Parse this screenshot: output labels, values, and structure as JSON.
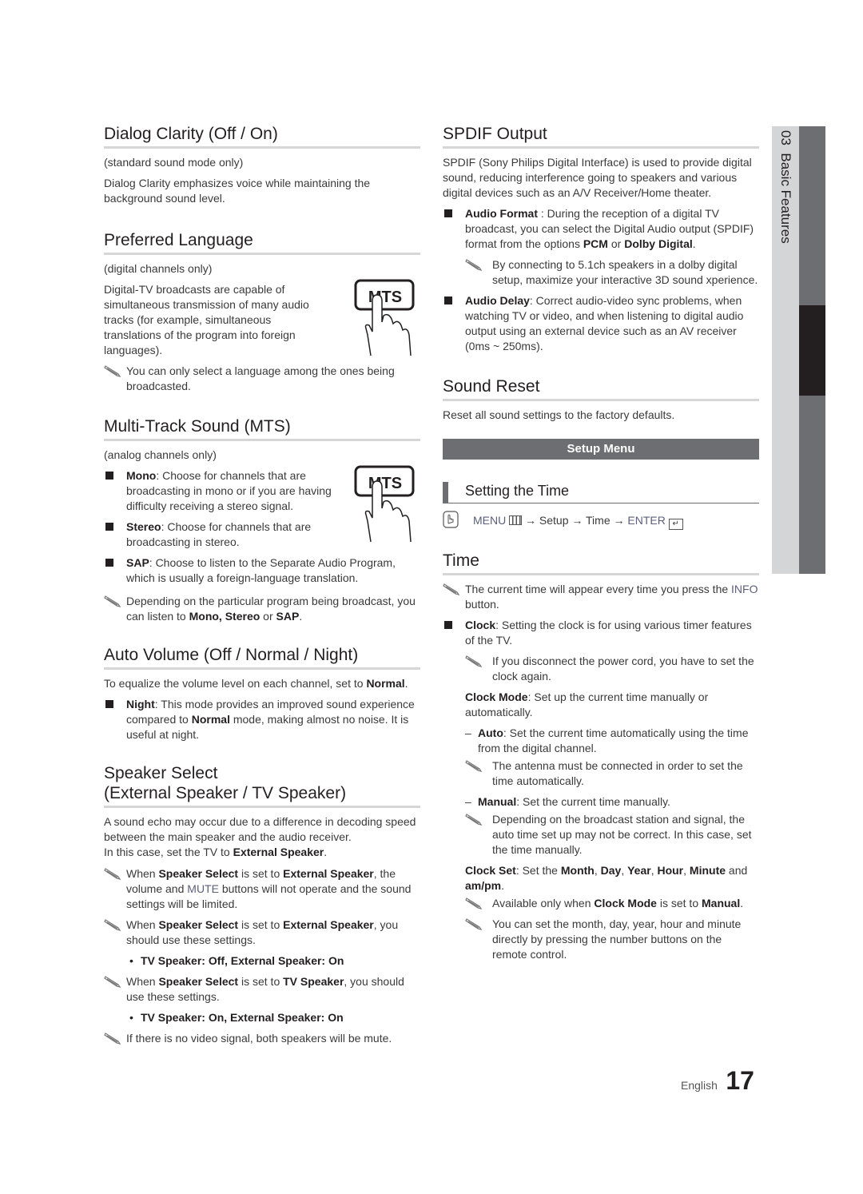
{
  "side_tab": {
    "chapter": "03",
    "title": "Basic Features"
  },
  "footer": {
    "language": "English",
    "page_number": "17"
  },
  "left": {
    "dialog_clarity": {
      "title": "Dialog Clarity (Off / On)",
      "scope": "(standard sound mode only)",
      "body": "Dialog Clarity emphasizes voice while maintaining the background sound level."
    },
    "preferred_language": {
      "title": "Preferred Language",
      "scope": "(digital channels only)",
      "body": "Digital-TV broadcasts are capable of simultaneous transmission of many audio tracks (for example, simultaneous translations of the program into foreign languages).",
      "note": "You can only select a language among the ones being broadcasted.",
      "remote_button": "MTS"
    },
    "mts": {
      "title": "Multi-Track Sound (MTS)",
      "scope": "(analog channels only)",
      "remote_button": "MTS",
      "items": [
        {
          "term": "Mono",
          "text": ": Choose for channels that are broadcasting in mono or if you are having difficulty receiving a stereo signal."
        },
        {
          "term": "Stereo",
          "text": ": Choose for channels that are broadcasting in stereo."
        },
        {
          "term": "SAP",
          "text": ": Choose to listen to the Separate Audio Program, which is usually a foreign-language translation."
        }
      ],
      "note_pre": "Depending on the particular program being broadcast, you can listen to ",
      "note_b1": "Mono, Stereo",
      "note_mid": " or ",
      "note_b2": "SAP",
      "note_end": "."
    },
    "auto_volume": {
      "title": "Auto Volume (Off / Normal / Night)",
      "intro_pre": "To equalize the volume level on each channel, set to ",
      "intro_b": "Normal",
      "intro_end": ".",
      "item_term": "Night",
      "item_pre": ": This mode provides an improved sound experience compared to ",
      "item_b": "Normal",
      "item_end": " mode, making almost no noise. It is useful at night."
    },
    "speaker_select": {
      "title_line1": "Speaker Select",
      "title_line2": "(External Speaker / TV Speaker)",
      "intro": "A sound echo may occur due to a difference in decoding speed between the main speaker and the audio receiver.",
      "intro2_pre": "In this case, set the TV to ",
      "intro2_b": "External Speaker",
      "intro2_end": ".",
      "note1": {
        "a": "When ",
        "b1": "Speaker Select",
        "c": " is set to ",
        "b2": "External Speaker",
        "d": ", the volume and ",
        "blue": "MUTE",
        "e": " buttons will not operate and the sound settings will be limited."
      },
      "note2": {
        "a": "When ",
        "b1": "Speaker Select",
        "c": " is set to ",
        "b2": "External Speaker",
        "d": ", you should use these settings."
      },
      "bullet1": "TV Speaker: Off, External Speaker: On",
      "note3": {
        "a": "When ",
        "b1": "Speaker Select",
        "c": " is set to ",
        "b2": "TV Speaker",
        "d": ", you should use these settings."
      },
      "bullet2": "TV Speaker: On, External Speaker: On",
      "note4": "If there is no video signal, both speakers will be mute."
    }
  },
  "right": {
    "spdif": {
      "title": "SPDIF Output",
      "body": "SPDIF (Sony Philips Digital Interface) is used to provide digital sound, reducing interference going to speakers and various digital devices such as an A/V Receiver/Home theater.",
      "audio_format": {
        "term": "Audio Format",
        "a": " : During the reception of a digital TV broadcast, you can select the Digital Audio output (SPDIF) format from the options ",
        "b1": "PCM",
        "c": " or ",
        "b2": "Dolby Digital",
        "d": "."
      },
      "audio_format_note": "By connecting to 5.1ch speakers in a dolby digital setup, maximize your interactive 3D sound xperience.",
      "audio_delay": {
        "term": "Audio Delay",
        "text": ": Correct audio-video sync problems, when watching TV or video, and when listening to digital audio output using an external device such as an AV receiver (0ms ~ 250ms)."
      }
    },
    "sound_reset": {
      "title": "Sound Reset",
      "body": "Reset all sound settings to the factory defaults."
    },
    "setup_menu_bar": "Setup Menu",
    "setting_time": {
      "title": "Setting the Time",
      "path_menu": "MENU",
      "path_mid": " → Setup → Time → ",
      "path_enter": "ENTER"
    },
    "time": {
      "title": "Time",
      "note_pre": "The current time will appear every time you press the ",
      "note_blue": "INFO",
      "note_end": " button.",
      "clock": {
        "term": "Clock",
        "text": ": Setting the clock is for using various timer features of the TV."
      },
      "clock_note": "If you disconnect the power cord, you have to set the clock again.",
      "clock_mode": {
        "term": "Clock Mode",
        "text": ": Set up the current time manually or automatically."
      },
      "auto": {
        "term": "Auto",
        "text": ": Set the current time automatically using the time from the digital channel."
      },
      "auto_note": "The antenna must be connected in order to set the time automatically.",
      "manual": {
        "term": "Manual",
        "text": ": Set the current time manually."
      },
      "manual_note": "Depending on the broadcast station and signal, the auto time set up may not be correct. In this case, set the time manually.",
      "clock_set": {
        "term": "Clock Set",
        "a": ": Set the ",
        "b1": "Month",
        "s1": ", ",
        "b2": "Day",
        "s2": ", ",
        "b3": "Year",
        "s3": ", ",
        "b4": "Hour",
        "s4": ", ",
        "b5": "Minute",
        "s5": " and ",
        "b6": "am/pm",
        "end": "."
      },
      "clock_set_note1": {
        "a": "Available only when ",
        "b1": "Clock Mode",
        "c": " is set to ",
        "b2": "Manual",
        "d": "."
      },
      "clock_set_note2": "You can set the month, day, year, hour and minute directly by pressing the number buttons on the remote control."
    }
  }
}
